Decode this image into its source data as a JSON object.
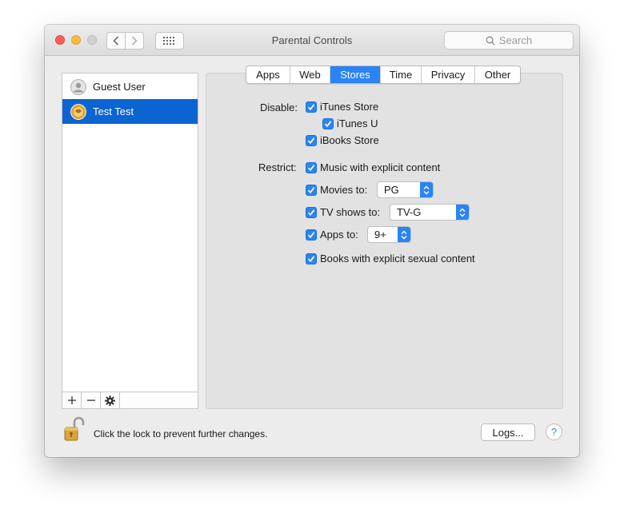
{
  "window": {
    "title": "Parental Controls"
  },
  "search": {
    "placeholder": "Search"
  },
  "users": [
    {
      "name": "Guest User"
    },
    {
      "name": "Test Test"
    }
  ],
  "tabs": [
    "Apps",
    "Web",
    "Stores",
    "Time",
    "Privacy",
    "Other"
  ],
  "selected_tab": "Stores",
  "disable": {
    "label": "Disable:",
    "items": [
      {
        "label": "iTunes Store",
        "checked": true
      },
      {
        "label": "iTunes U",
        "checked": true
      },
      {
        "label": "iBooks Store",
        "checked": true
      }
    ]
  },
  "restrict": {
    "label": "Restrict:",
    "music": {
      "label": "Music with explicit content",
      "checked": true
    },
    "movies": {
      "label": "Movies to:",
      "checked": true,
      "value": "PG"
    },
    "tv": {
      "label": "TV shows to:",
      "checked": true,
      "value": "TV-G"
    },
    "apps": {
      "label": "Apps to:",
      "checked": true,
      "value": "9+"
    },
    "books": {
      "label": "Books with explicit sexual content",
      "checked": true
    }
  },
  "footer": {
    "lock_text": "Click the lock to prevent further changes.",
    "logs_label": "Logs...",
    "help_label": "?"
  },
  "colors": {
    "accent": "#2a84f5",
    "selection": "#0a64d2"
  }
}
